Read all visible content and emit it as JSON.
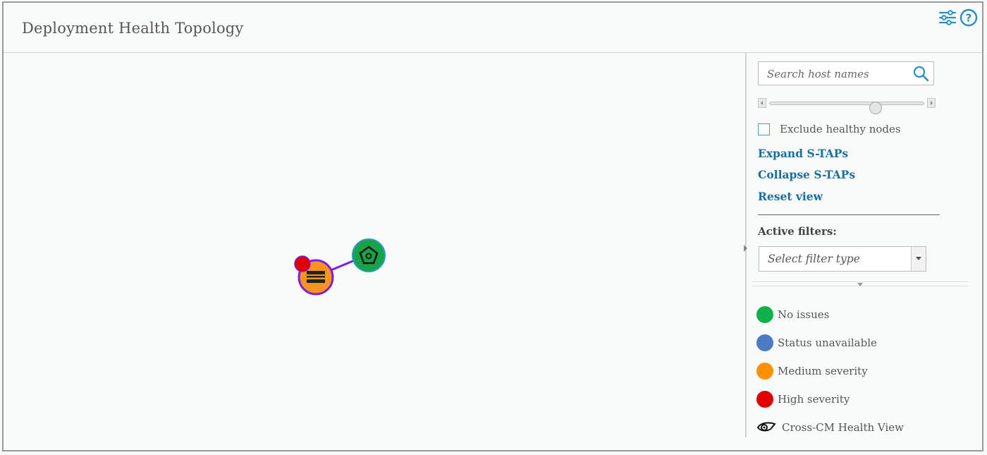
{
  "header": {
    "title": "Deployment Health Topology",
    "icons": [
      "settings-sliders-icon",
      "help-icon"
    ]
  },
  "graph": {
    "nodes": [
      {
        "name": "stap-node",
        "status": "medium",
        "icon": "stap-icon",
        "color": "#f7941d",
        "ring": "#7b1fe4",
        "badge": "high",
        "badge_color": "#e00000"
      },
      {
        "name": "cm-node",
        "status": "ok",
        "icon": "pentagon-target-icon",
        "color": "#17a34a",
        "ring": "#2c9bc4"
      }
    ],
    "edge_color": "#7b1fe4"
  },
  "panel": {
    "search": {
      "placeholder": "Search host names"
    },
    "slider": {
      "value_fraction": 0.68
    },
    "exclude_label": "Exclude healthy nodes",
    "exclude_checked": false,
    "links": {
      "expand": "Expand S-TAPs",
      "collapse": "Collapse S-TAPs",
      "reset": "Reset view"
    },
    "active_filters_label": "Active filters:",
    "filter_select": {
      "placeholder": "Select filter type"
    }
  },
  "legend": {
    "no_issues": {
      "label": "No issues",
      "color": "#0fb14b"
    },
    "unavailable": {
      "label": "Status unavailable",
      "color": "#4a7bc4"
    },
    "medium": {
      "label": "Medium severity",
      "color": "#ff9100"
    },
    "high": {
      "label": "High severity",
      "color": "#e00000"
    },
    "cross_cm": {
      "label": "Cross-CM Health View",
      "icon": "cross-cm-eye-icon"
    }
  },
  "colors": {
    "link": "#1a6fa0",
    "accent": "#2c8fc7"
  }
}
